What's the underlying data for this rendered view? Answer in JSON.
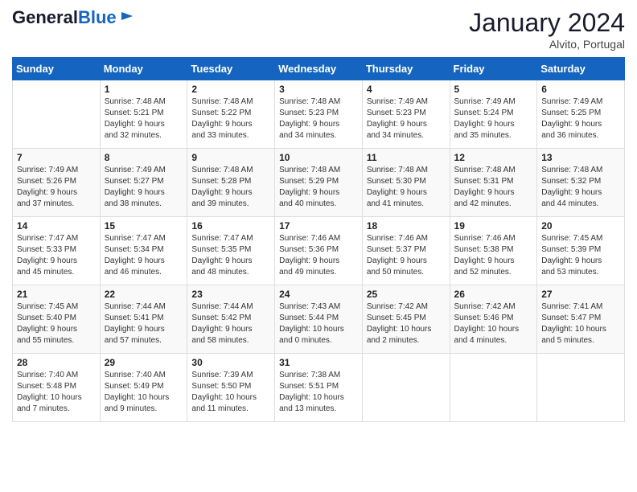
{
  "logo": {
    "line1": "General",
    "line2": "Blue"
  },
  "header": {
    "month": "January 2024",
    "location": "Alvito, Portugal"
  },
  "weekdays": [
    "Sunday",
    "Monday",
    "Tuesday",
    "Wednesday",
    "Thursday",
    "Friday",
    "Saturday"
  ],
  "weeks": [
    [
      {
        "day": "",
        "text": ""
      },
      {
        "day": "1",
        "text": "Sunrise: 7:48 AM\nSunset: 5:21 PM\nDaylight: 9 hours\nand 32 minutes."
      },
      {
        "day": "2",
        "text": "Sunrise: 7:48 AM\nSunset: 5:22 PM\nDaylight: 9 hours\nand 33 minutes."
      },
      {
        "day": "3",
        "text": "Sunrise: 7:48 AM\nSunset: 5:23 PM\nDaylight: 9 hours\nand 34 minutes."
      },
      {
        "day": "4",
        "text": "Sunrise: 7:49 AM\nSunset: 5:23 PM\nDaylight: 9 hours\nand 34 minutes."
      },
      {
        "day": "5",
        "text": "Sunrise: 7:49 AM\nSunset: 5:24 PM\nDaylight: 9 hours\nand 35 minutes."
      },
      {
        "day": "6",
        "text": "Sunrise: 7:49 AM\nSunset: 5:25 PM\nDaylight: 9 hours\nand 36 minutes."
      }
    ],
    [
      {
        "day": "7",
        "text": "Sunrise: 7:49 AM\nSunset: 5:26 PM\nDaylight: 9 hours\nand 37 minutes."
      },
      {
        "day": "8",
        "text": "Sunrise: 7:49 AM\nSunset: 5:27 PM\nDaylight: 9 hours\nand 38 minutes."
      },
      {
        "day": "9",
        "text": "Sunrise: 7:48 AM\nSunset: 5:28 PM\nDaylight: 9 hours\nand 39 minutes."
      },
      {
        "day": "10",
        "text": "Sunrise: 7:48 AM\nSunset: 5:29 PM\nDaylight: 9 hours\nand 40 minutes."
      },
      {
        "day": "11",
        "text": "Sunrise: 7:48 AM\nSunset: 5:30 PM\nDaylight: 9 hours\nand 41 minutes."
      },
      {
        "day": "12",
        "text": "Sunrise: 7:48 AM\nSunset: 5:31 PM\nDaylight: 9 hours\nand 42 minutes."
      },
      {
        "day": "13",
        "text": "Sunrise: 7:48 AM\nSunset: 5:32 PM\nDaylight: 9 hours\nand 44 minutes."
      }
    ],
    [
      {
        "day": "14",
        "text": "Sunrise: 7:47 AM\nSunset: 5:33 PM\nDaylight: 9 hours\nand 45 minutes."
      },
      {
        "day": "15",
        "text": "Sunrise: 7:47 AM\nSunset: 5:34 PM\nDaylight: 9 hours\nand 46 minutes."
      },
      {
        "day": "16",
        "text": "Sunrise: 7:47 AM\nSunset: 5:35 PM\nDaylight: 9 hours\nand 48 minutes."
      },
      {
        "day": "17",
        "text": "Sunrise: 7:46 AM\nSunset: 5:36 PM\nDaylight: 9 hours\nand 49 minutes."
      },
      {
        "day": "18",
        "text": "Sunrise: 7:46 AM\nSunset: 5:37 PM\nDaylight: 9 hours\nand 50 minutes."
      },
      {
        "day": "19",
        "text": "Sunrise: 7:46 AM\nSunset: 5:38 PM\nDaylight: 9 hours\nand 52 minutes."
      },
      {
        "day": "20",
        "text": "Sunrise: 7:45 AM\nSunset: 5:39 PM\nDaylight: 9 hours\nand 53 minutes."
      }
    ],
    [
      {
        "day": "21",
        "text": "Sunrise: 7:45 AM\nSunset: 5:40 PM\nDaylight: 9 hours\nand 55 minutes."
      },
      {
        "day": "22",
        "text": "Sunrise: 7:44 AM\nSunset: 5:41 PM\nDaylight: 9 hours\nand 57 minutes."
      },
      {
        "day": "23",
        "text": "Sunrise: 7:44 AM\nSunset: 5:42 PM\nDaylight: 9 hours\nand 58 minutes."
      },
      {
        "day": "24",
        "text": "Sunrise: 7:43 AM\nSunset: 5:44 PM\nDaylight: 10 hours\nand 0 minutes."
      },
      {
        "day": "25",
        "text": "Sunrise: 7:42 AM\nSunset: 5:45 PM\nDaylight: 10 hours\nand 2 minutes."
      },
      {
        "day": "26",
        "text": "Sunrise: 7:42 AM\nSunset: 5:46 PM\nDaylight: 10 hours\nand 4 minutes."
      },
      {
        "day": "27",
        "text": "Sunrise: 7:41 AM\nSunset: 5:47 PM\nDaylight: 10 hours\nand 5 minutes."
      }
    ],
    [
      {
        "day": "28",
        "text": "Sunrise: 7:40 AM\nSunset: 5:48 PM\nDaylight: 10 hours\nand 7 minutes."
      },
      {
        "day": "29",
        "text": "Sunrise: 7:40 AM\nSunset: 5:49 PM\nDaylight: 10 hours\nand 9 minutes."
      },
      {
        "day": "30",
        "text": "Sunrise: 7:39 AM\nSunset: 5:50 PM\nDaylight: 10 hours\nand 11 minutes."
      },
      {
        "day": "31",
        "text": "Sunrise: 7:38 AM\nSunset: 5:51 PM\nDaylight: 10 hours\nand 13 minutes."
      },
      {
        "day": "",
        "text": ""
      },
      {
        "day": "",
        "text": ""
      },
      {
        "day": "",
        "text": ""
      }
    ]
  ]
}
